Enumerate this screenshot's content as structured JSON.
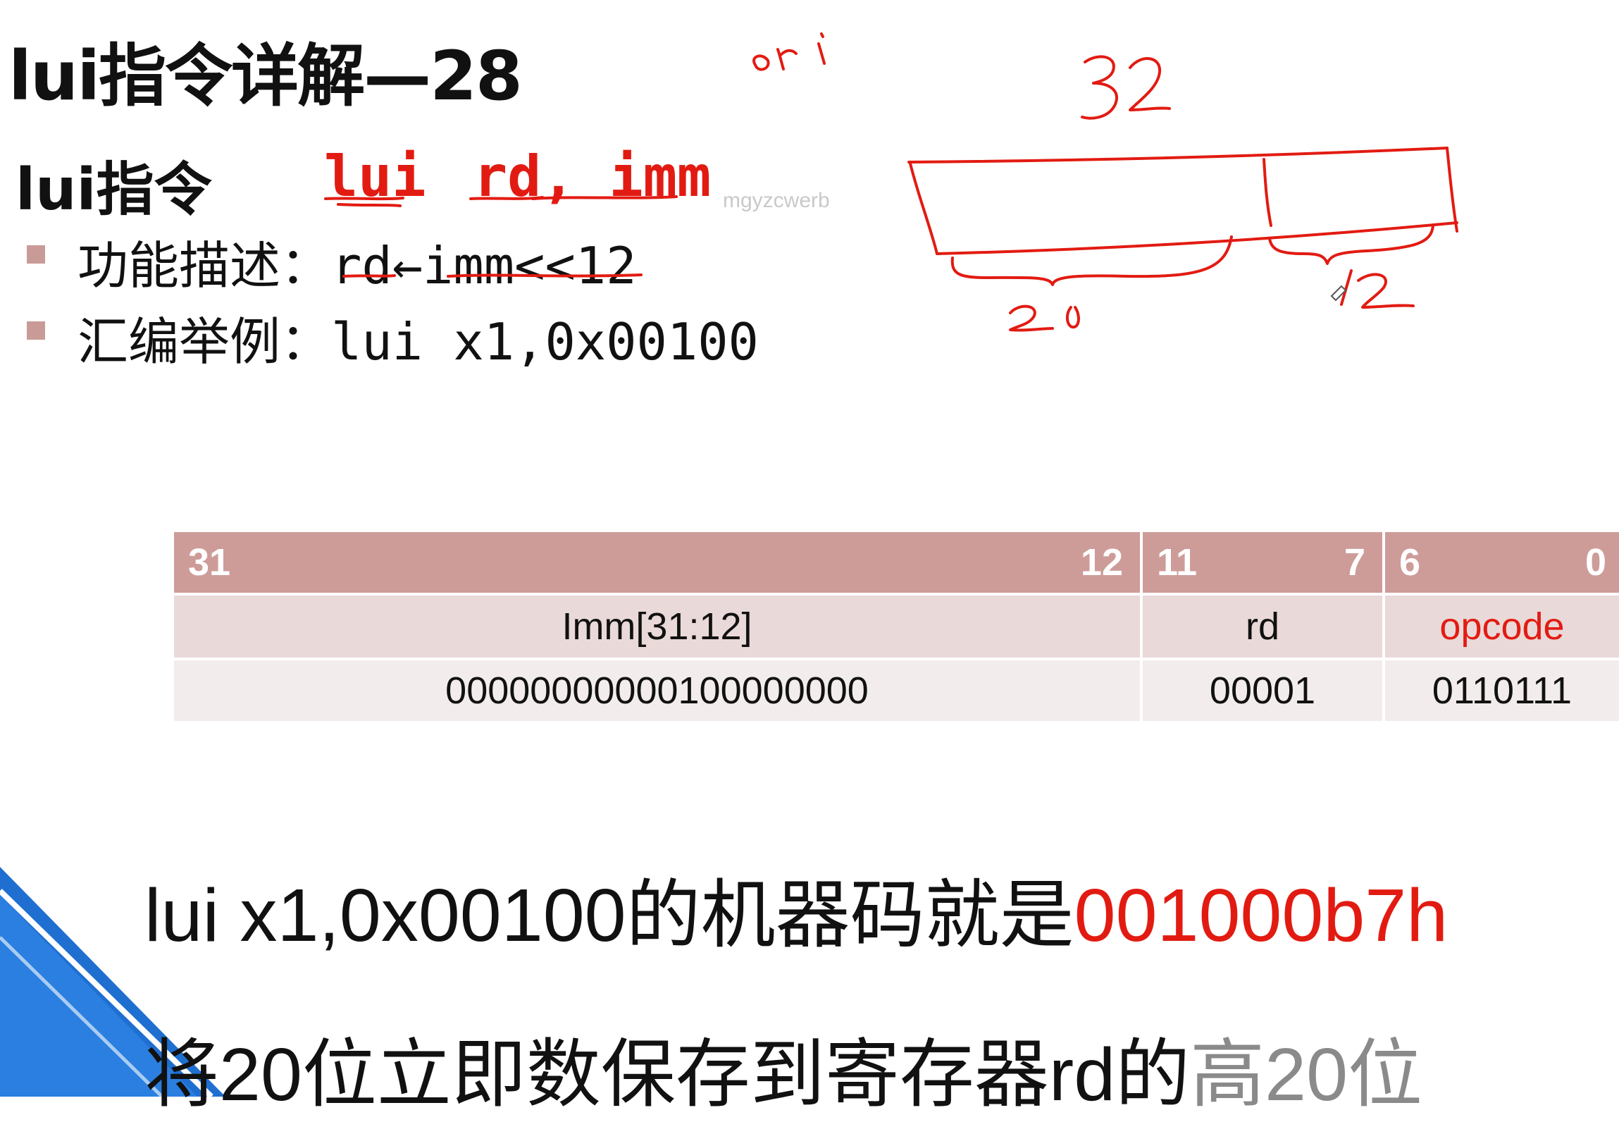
{
  "slide": {
    "title": "lui指令详解—28",
    "subtitle": "lui指令",
    "syntax": {
      "mnemonic": "lui",
      "operands": "rd, imm"
    },
    "bullets": [
      {
        "label": "功能描述：",
        "value": "rd←imm<<12"
      },
      {
        "label": "汇编举例：",
        "value": "lui x1,0x00100"
      }
    ],
    "watermark": "mgyzcwerb",
    "table": {
      "header": [
        {
          "hi": "31",
          "lo": "12"
        },
        {
          "hi": "11",
          "lo": "7"
        },
        {
          "hi": "6",
          "lo": "0"
        }
      ],
      "fields": [
        "Imm[31:12]",
        "rd",
        "opcode"
      ],
      "values": [
        "00000000000100000000",
        "00001",
        "0110111"
      ]
    },
    "statement": {
      "prefix": "lui x1,0x00100的机器码就是",
      "code": "001000b7h"
    },
    "footer": {
      "main": "将20位立即数保存到寄存器rd的",
      "tail": "高20位"
    }
  },
  "annotations": {
    "color": "#e21b12",
    "handwritten": [
      "ori",
      "32",
      "20",
      "12"
    ]
  },
  "colors": {
    "header_bg": "#cd9c99",
    "row1_bg": "#e9d9d8",
    "row2_bg": "#f3ecec",
    "accent_red": "#e21b12",
    "corner_blue": "#1f6fd1"
  }
}
